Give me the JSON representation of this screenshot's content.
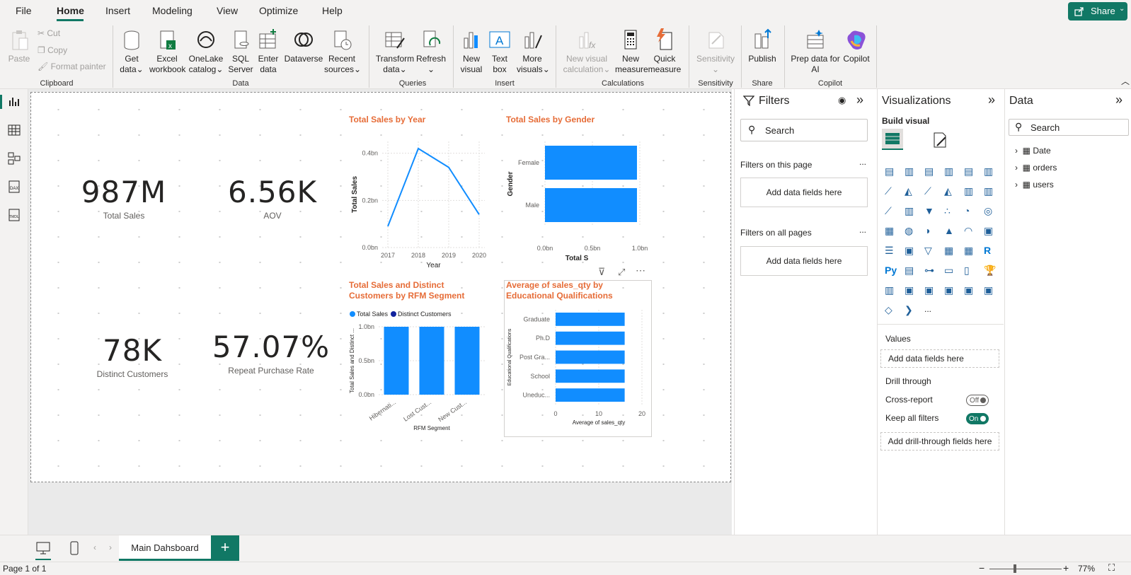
{
  "menu": {
    "items": [
      "File",
      "Home",
      "Insert",
      "Modeling",
      "View",
      "Optimize",
      "Help"
    ],
    "active": "Home",
    "share": "Share"
  },
  "ribbon": {
    "clipboard": {
      "paste": "Paste",
      "cut": "Cut",
      "copy": "Copy",
      "format_painter": "Format painter",
      "group": "Clipboard"
    },
    "data": {
      "get_data": [
        "Get",
        "data"
      ],
      "excel": [
        "Excel",
        "workbook"
      ],
      "onelake": [
        "OneLake",
        "catalog"
      ],
      "sql": [
        "SQL",
        "Server"
      ],
      "enter": [
        "Enter",
        "data"
      ],
      "dataverse": "Dataverse",
      "recent": [
        "Recent",
        "sources"
      ],
      "group": "Data"
    },
    "queries": {
      "transform": [
        "Transform",
        "data"
      ],
      "refresh": "Refresh",
      "group": "Queries"
    },
    "insert": {
      "new_visual": [
        "New",
        "visual"
      ],
      "text_box": [
        "Text",
        "box"
      ],
      "more_visuals": [
        "More",
        "visuals"
      ],
      "group": "Insert"
    },
    "calculations": {
      "new_visual_calc": [
        "New visual",
        "calculation"
      ],
      "new_measure": [
        "New",
        "measure"
      ],
      "quick_measure": [
        "Quick",
        "measure"
      ],
      "group": "Calculations"
    },
    "sensitivity": {
      "label": "Sensitivity",
      "group": "Sensitivity"
    },
    "share": {
      "publish": "Publish",
      "group": "Share"
    },
    "copilot": {
      "prep": [
        "Prep data for",
        "AI"
      ],
      "copilot": "Copilot",
      "group": "Copilot"
    }
  },
  "kpis": [
    {
      "value": "987M",
      "label": "Total Sales"
    },
    {
      "value": "6.56K",
      "label": "AOV"
    },
    {
      "value": "78K",
      "label": "Distinct Customers"
    },
    {
      "value": "57.07%",
      "label": "Repeat Purchase Rate"
    }
  ],
  "chart_data": [
    {
      "type": "line",
      "title": "Total Sales by Year",
      "xlabel": "Year",
      "ylabel": "Total Sales",
      "x": [
        "2017",
        "2018",
        "2019",
        "2020"
      ],
      "series": [
        {
          "values": [
            0.09,
            0.42,
            0.34,
            0.14
          ]
        }
      ],
      "yticks": [
        "0.0bn",
        "0.2bn",
        "0.4bn"
      ],
      "ylim": [
        0,
        0.45
      ],
      "color": "#118dff"
    },
    {
      "type": "bar",
      "title": "Total Sales by Gender",
      "xlabel": "Total S",
      "ylabel": "Gender",
      "categories": [
        "Female",
        "Male"
      ],
      "values": [
        0.97,
        0.97
      ],
      "xticks": [
        "0.0bn",
        "0.5bn",
        "1.0bn"
      ],
      "xlim": [
        0,
        1.0
      ],
      "color": "#118dff"
    },
    {
      "type": "bar",
      "title": "Total Sales and Distinct Customers by RFM Segment",
      "xlabel": "RFM Segment",
      "ylabel": "Total Sales and Distinct ...",
      "categories": [
        "Hibernati...",
        "Lost Cust...",
        "New Cust..."
      ],
      "series": [
        {
          "name": "Total Sales",
          "values": [
            1.0,
            1.0,
            1.0
          ],
          "color": "#118dff"
        },
        {
          "name": "Distinct Customers",
          "values": [
            0,
            0,
            0
          ],
          "color": "#12239e"
        }
      ],
      "yticks": [
        "0.0bn",
        "0.5bn",
        "1.0bn"
      ],
      "ylim": [
        0,
        1.0
      ]
    },
    {
      "type": "bar",
      "title": "Average of sales_qty by Educational Qualifications",
      "xlabel": "Average of sales_qty",
      "ylabel": "Educational Qualifications",
      "categories": [
        "Graduate",
        "Ph.D",
        "Post Gra...",
        "School",
        "Uneduc..."
      ],
      "values": [
        16,
        16,
        16,
        16,
        16
      ],
      "xticks": [
        "0",
        "10",
        "20"
      ],
      "xlim": [
        0,
        20
      ],
      "color": "#118dff"
    }
  ],
  "filters": {
    "title": "Filters",
    "search_placeholder": "Search",
    "on_page": "Filters on this page",
    "on_all": "Filters on all pages",
    "add_fields": "Add data fields here",
    "more": "..."
  },
  "visualizations": {
    "title": "Visualizations",
    "build": "Build visual",
    "values": "Values",
    "add_fields": "Add data fields here",
    "drill": "Drill through",
    "cross_report": "Cross-report",
    "cross_report_state": "Off",
    "keep_filters": "Keep all filters",
    "keep_filters_state": "On",
    "add_drill": "Add drill-through fields here",
    "more": "..."
  },
  "data_pane": {
    "title": "Data",
    "search_placeholder": "Search",
    "tables": [
      "Date",
      "orders",
      "users"
    ]
  },
  "tabs": {
    "page": "Main Dahsboard",
    "add": "+"
  },
  "status": {
    "page": "Page 1 of 1",
    "zoom": "77%"
  },
  "colors": {
    "accent": "#117865",
    "title": "#e66c37",
    "bar": "#118dff",
    "series2": "#12239e"
  }
}
